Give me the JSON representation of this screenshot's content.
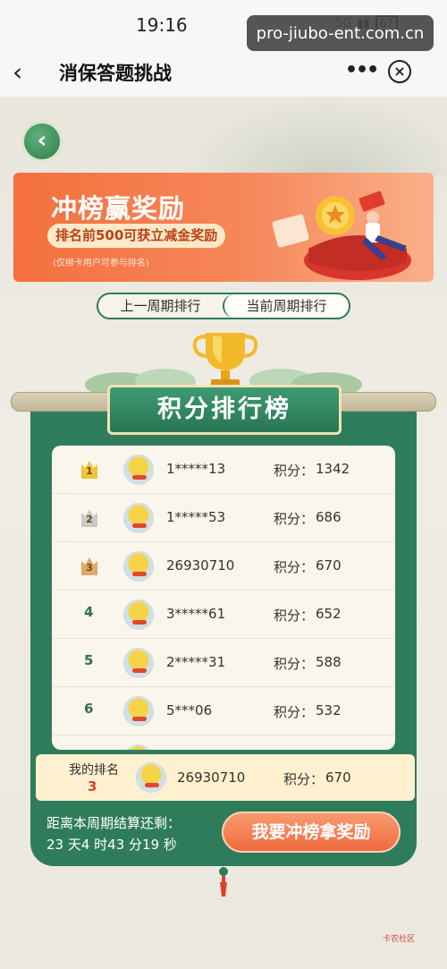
{
  "status": {
    "time": "19:16",
    "signal": "5G",
    "battery": "67"
  },
  "watermark": "pro-jiubo-ent.com.cn",
  "nav": {
    "title": "消保答题挑战"
  },
  "banner": {
    "title": "冲榜赢奖励",
    "pill": "排名前500可获立减金奖励",
    "note": "(仅绑卡用户可参与排名)"
  },
  "tabs": [
    {
      "label": "上一周期排行",
      "active": false
    },
    {
      "label": "当前周期排行",
      "active": true
    }
  ],
  "board": {
    "title": "积分排行榜",
    "score_label": "积分：",
    "rows": [
      {
        "rank": "1",
        "name": "1*****13",
        "score": "1342",
        "medal": "gold"
      },
      {
        "rank": "2",
        "name": "1*****53",
        "score": "686",
        "medal": "silver"
      },
      {
        "rank": "3",
        "name": "26930710",
        "score": "670",
        "medal": "bronze"
      },
      {
        "rank": "4",
        "name": "3*****61",
        "score": "652",
        "medal": ""
      },
      {
        "rank": "5",
        "name": "2*****31",
        "score": "588",
        "medal": ""
      },
      {
        "rank": "6",
        "name": "5***06",
        "score": "532",
        "medal": ""
      }
    ]
  },
  "my_rank": {
    "label": "我的排名",
    "rank": "3",
    "name": "26930710",
    "score_label": "积分：",
    "score": "670"
  },
  "countdown": {
    "label": "距离本周期结算还剩：",
    "value": "23 天4 时43 分19 秒"
  },
  "cta_label": "我要冲榜拿奖励",
  "corner_logo": "卡农社区",
  "colors": {
    "accent_green": "#2f7c5c",
    "banner_orange": "#f4703d",
    "cta_orange": "#ef6b3f",
    "gold": "#f2c23a",
    "silver": "#c9c9c9",
    "bronze": "#e0a76a"
  }
}
